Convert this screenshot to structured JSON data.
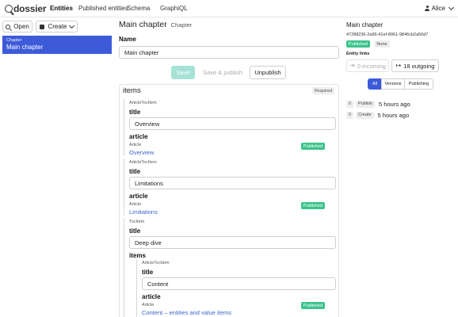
{
  "nav": {
    "brand": "dossier",
    "links": [
      "Entities",
      "Published entities",
      "Schema",
      "GraphiQL"
    ],
    "active": "Entities",
    "user": "Alice"
  },
  "left": {
    "open_label": "Open",
    "create_label": "Create",
    "selected": {
      "type": "Chapter",
      "name": "Main chapter"
    }
  },
  "editor": {
    "title": "Main chapter",
    "subtitle": "Chapter",
    "name_label": "Name",
    "name_value": "Main chapter",
    "buttons": {
      "save": "Save",
      "save_publish": "Save & publish",
      "unpublish": "Unpublish"
    },
    "items_label": "items",
    "required": "Required",
    "items": [
      {
        "type": "ArticleTocItem",
        "title_label": "title",
        "title_value": "Overview",
        "article_label": "article",
        "article_type": "Article",
        "article_link": "Overview",
        "status": "Published"
      },
      {
        "type": "ArticleTocItem",
        "title_label": "title",
        "title_value": "Limitations",
        "article_label": "article",
        "article_type": "Article",
        "article_link": "Limitations",
        "status": "Published"
      },
      {
        "type": "TocItem",
        "title_label": "title",
        "title_value": "Deep dive",
        "items_label": "items",
        "sub": {
          "type": "ArticleTocItem",
          "title_label": "title",
          "title_value": "Content",
          "article_label": "article",
          "article_type": "Article",
          "article_link": "Content – entities and value items",
          "status": "Published"
        }
      }
    ]
  },
  "info": {
    "title": "Main chapter",
    "id": "47288236-2a96-41ef-8061-9846cb2a50d7",
    "status": "Published",
    "auth": "None",
    "links_label": "Entity links",
    "incoming": "0 incoming",
    "outgoing": "18 outgoing",
    "tabs": [
      "All",
      "Versions",
      "Publishing"
    ],
    "active_tab": "All",
    "history": [
      {
        "version": "0",
        "event": "Publish",
        "time": "5 hours ago"
      },
      {
        "version": "0",
        "event": "Create",
        "time": "5 hours ago"
      }
    ]
  },
  "colors": {
    "accent": "#3d5bd9",
    "published": "#3cc38c",
    "link": "#3d66c9",
    "save_disabled": "#a6e2d5"
  }
}
